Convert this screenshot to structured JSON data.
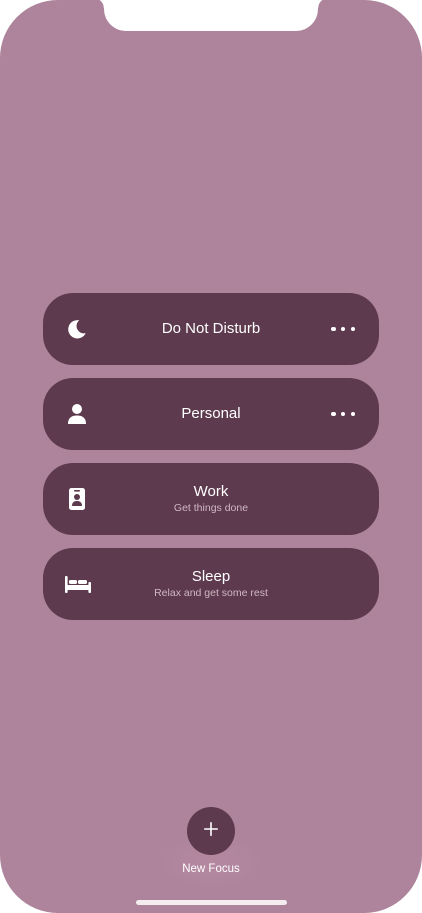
{
  "focus_modes": [
    {
      "title": "Do Not Disturb",
      "subtitle": "",
      "icon": "moon-icon",
      "has_more": true
    },
    {
      "title": "Personal",
      "subtitle": "",
      "icon": "person-icon",
      "has_more": true
    },
    {
      "title": "Work",
      "subtitle": "Get things done",
      "icon": "id-badge-icon",
      "has_more": false
    },
    {
      "title": "Sleep",
      "subtitle": "Relax and get some rest",
      "icon": "bed-icon",
      "has_more": false
    }
  ],
  "new_focus": {
    "label": "New Focus",
    "icon": "plus-icon"
  },
  "colors": {
    "background": "#ad849c",
    "tile": "#5d3a4d",
    "subtitle": "#cfb7c4"
  }
}
